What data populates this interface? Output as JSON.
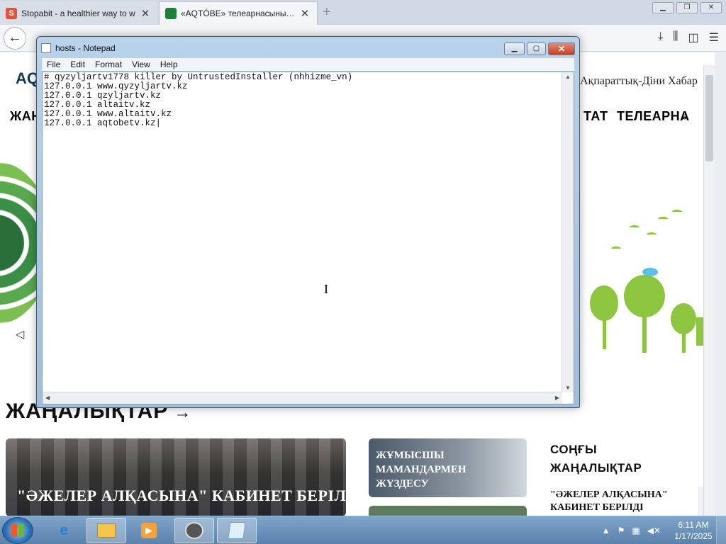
{
  "browser": {
    "tabs": [
      {
        "title": "Stopabit - a healthier way to w",
        "favicon": "S",
        "active": false
      },
      {
        "title": "«AQTÓBE» телеарнасының ре",
        "favicon": "",
        "active": true
      }
    ],
    "new_tab": "+",
    "back": "←",
    "window_controls": {
      "minimize": "▁",
      "restore": "❐",
      "close": "✕"
    },
    "toolbar_icons": [
      "download-icon",
      "library-icon",
      "sidebar-icon",
      "menu-icon"
    ]
  },
  "site": {
    "logo": "AQ",
    "tagline": "Ақпараттық-Діни Хабар",
    "menu": [
      "ЖАҢ",
      "ТАТ",
      "ТЕЛЕАРНА"
    ],
    "search_icon": "⌕",
    "hero_prev": "◁",
    "news_heading": "ЖАҢАЛЫҚТАР",
    "news_arrow": "→",
    "card_big_caption": "\"ӘЖЕЛЕР АЛҚАСЫНА\" КАБИНЕТ БЕРІЛДІ",
    "card_small_caption": "ЖҰМЫСШЫ МАМАНДАРМЕН ЖҮЗДЕСУ",
    "latest_heading": "СОҢҒЫ ЖАҢАЛЫҚТАР",
    "latest_item": "\"ӘЖЕЛЕР АЛҚАСЫНА\" КАБИНЕТ БЕРІЛДІ"
  },
  "notepad": {
    "title": "hosts - Notepad",
    "menu": [
      "File",
      "Edit",
      "Format",
      "View",
      "Help"
    ],
    "content": "# qyzyljartv1778 killer by UntrustedInstaller (nhhizme_vn)\n127.0.0.1 www.qyzyljartv.kz\n127.0.0.1 qzyljartv.kz\n127.0.0.1 altaitv.kz\n127.0.0.1 www.altaitv.kz\n127.0.0.1 aqtobetv.kz|",
    "controls": {
      "minimize": "▁",
      "maximize": "▢",
      "close": "✕"
    }
  },
  "taskbar": {
    "pinned": [
      "ie-icon",
      "explorer-icon",
      "media-player-icon"
    ],
    "open": [
      "raccoon-app-icon",
      "notepad-icon"
    ],
    "tray_arrow": "▲",
    "time": "6:11 AM",
    "date": "1/17/2025"
  },
  "colors": {
    "green": "#8cc63f",
    "notepad_frame": "#b8d2ea",
    "taskbar": "#6a91b8"
  }
}
